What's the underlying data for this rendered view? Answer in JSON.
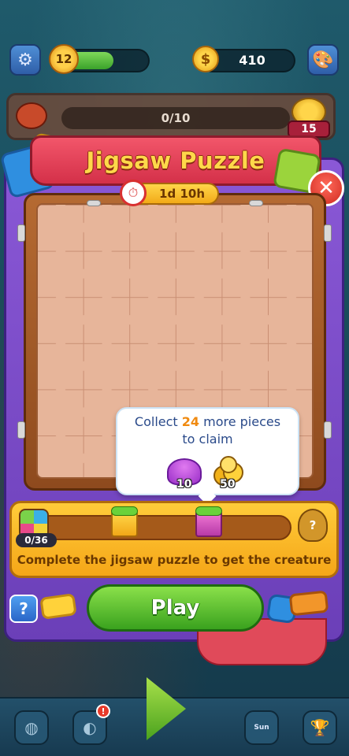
{
  "top_bar": {
    "settings_icon": "gear-icon",
    "level": "12",
    "level_progress_fraction": 0.56,
    "coins": "410",
    "extra_icon": "palette-icon"
  },
  "quest": {
    "progress": "0/10",
    "reward_count": "15"
  },
  "dialog": {
    "title": "Jigsaw Puzzle",
    "timer": "1d 10h",
    "close_icon": "close-icon"
  },
  "tooltip": {
    "prefix": "Collect ",
    "highlight": "24",
    "suffix": " more pieces",
    "line2": "to claim",
    "reward_shells": "10",
    "reward_coins": "50"
  },
  "progress": {
    "count": "0/36",
    "caption": "Complete the jigsaw puzzle to get the creature",
    "fill_fraction": 0.0,
    "mystery_label": "?"
  },
  "buttons": {
    "help": "?",
    "play": "Play"
  },
  "navbar": {
    "notification": "!",
    "calendar_label": "Sun"
  },
  "colors": {
    "title_yellow": "#ffd84a",
    "frame_purple": "#8a58d6",
    "play_green": "#3aa21e",
    "panel_orange": "#f5a618"
  }
}
